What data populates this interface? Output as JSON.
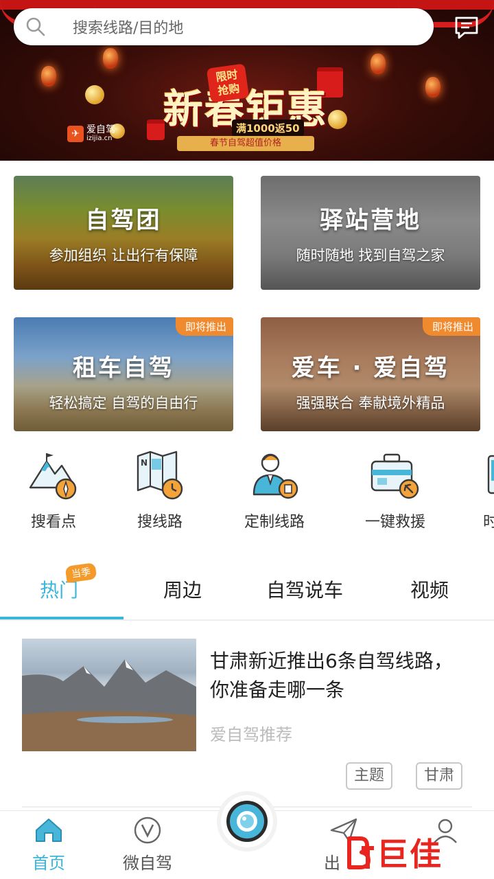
{
  "search": {
    "placeholder": "搜索线路/目的地"
  },
  "banner": {
    "promo_title": "新春钜惠",
    "promo_badge_line1": "限时",
    "promo_badge_line2": "抢购",
    "promo_sub": "满1000返50",
    "promo_ribbon": "春节自驾超值价格",
    "brand_name": "爱自驾",
    "brand_url": "izijia.cn"
  },
  "cards": [
    {
      "title": "自驾团",
      "subtitle": "参加组织 让出行有保障",
      "tag": ""
    },
    {
      "title": "驿站营地",
      "subtitle": "随时随地 找到自驾之家",
      "tag": ""
    },
    {
      "title": "租车自驾",
      "subtitle": "轻松搞定 自驾的自由行",
      "tag": "即将推出"
    },
    {
      "title": "爱车 · 爱自驾",
      "subtitle": "强强联合 奉献境外精品",
      "tag": "即将推出"
    }
  ],
  "quick": [
    {
      "label": "搜看点",
      "icon": "mountain-compass-icon"
    },
    {
      "label": "搜线路",
      "icon": "map-clock-icon"
    },
    {
      "label": "定制线路",
      "icon": "person-badge-icon"
    },
    {
      "label": "一键救援",
      "icon": "toolbox-wrench-icon"
    },
    {
      "label": "时",
      "icon": "partial-icon"
    }
  ],
  "tabs": [
    {
      "label": "热门",
      "active": true
    },
    {
      "label": "周边",
      "active": false
    },
    {
      "label": "自驾说车",
      "active": false
    },
    {
      "label": "视频",
      "active": false
    }
  ],
  "season_badge": "当季",
  "article": {
    "title": "甘肃新近推出6条自驾线路，你准备走哪一条",
    "source": "爱自驾推荐",
    "tags": [
      "主题",
      "甘肃"
    ]
  },
  "bottom_nav": [
    {
      "label": "首页",
      "active": true,
      "icon": "home-icon"
    },
    {
      "label": "微自驾",
      "active": false,
      "icon": "v-circle-icon"
    },
    {
      "label": "出",
      "active": false,
      "icon": "paper-plane-icon"
    },
    {
      "label": "",
      "active": false,
      "icon": "user-icon"
    }
  ],
  "watermark": {
    "text": "巨佳"
  },
  "colors": {
    "accent": "#39b6d8",
    "tag_orange": "#f08a2e",
    "watermark_red": "#e8251f"
  }
}
